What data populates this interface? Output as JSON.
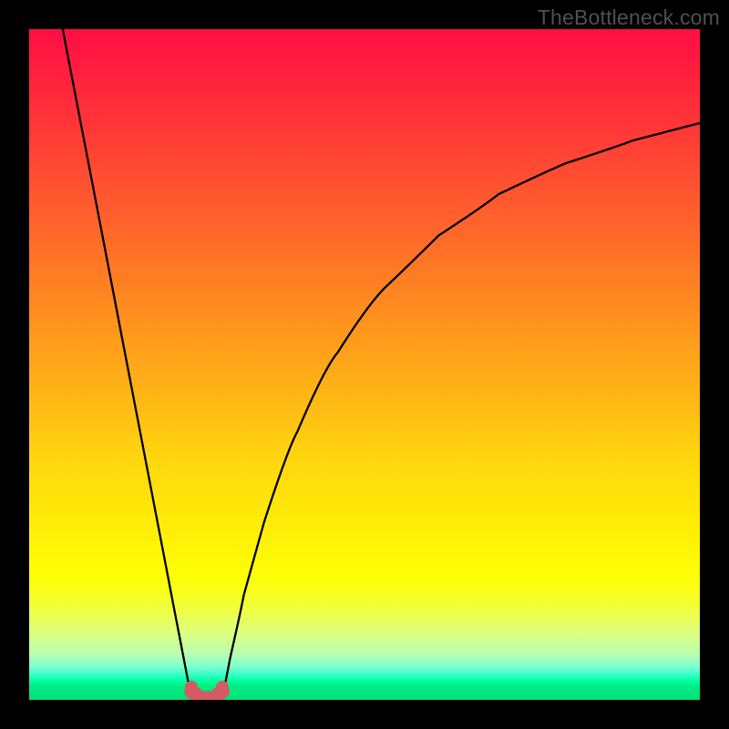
{
  "watermark": "TheBottleneck.com",
  "chart_data": {
    "type": "line",
    "title": "",
    "xlabel": "",
    "ylabel": "",
    "xlim": [
      0,
      1
    ],
    "ylim": [
      0,
      100
    ],
    "grid": false,
    "legend": false,
    "gradient_stops": [
      {
        "pos": 0.0,
        "color": "#ff0e44"
      },
      {
        "pos": 0.16,
        "color": "#ff3b36"
      },
      {
        "pos": 0.36,
        "color": "#ff7a24"
      },
      {
        "pos": 0.56,
        "color": "#ffba14"
      },
      {
        "pos": 0.72,
        "color": "#ffe808"
      },
      {
        "pos": 0.82,
        "color": "#fdff06"
      },
      {
        "pos": 0.9,
        "color": "#dcff80"
      },
      {
        "pos": 0.95,
        "color": "#7effd0"
      },
      {
        "pos": 0.98,
        "color": "#00ec82"
      },
      {
        "pos": 1.0,
        "color": "#00e27a"
      }
    ],
    "series": [
      {
        "name": "left",
        "x": [
          0.05,
          0.08,
          0.11,
          0.14,
          0.17,
          0.2,
          0.215,
          0.23,
          0.24
        ],
        "y": [
          100.0,
          84.4,
          68.8,
          53.2,
          37.6,
          22.0,
          14.2,
          6.4,
          1.2
        ]
      },
      {
        "name": "right",
        "x": [
          0.29,
          0.3,
          0.32,
          0.35,
          0.4,
          0.46,
          0.53,
          0.61,
          0.7,
          0.8,
          0.9,
          1.0
        ],
        "y": [
          1.2,
          6.4,
          15.6,
          26.4,
          40.0,
          51.8,
          61.4,
          69.2,
          75.4,
          80.0,
          83.4,
          86.0
        ]
      }
    ],
    "flat_region": {
      "x_start": 0.24,
      "x_end": 0.29,
      "y": 1.2,
      "color": "#d35b61",
      "endpoint_radius": 7
    },
    "curve_stroke": {
      "color": "#000000",
      "width": 2.3
    }
  }
}
